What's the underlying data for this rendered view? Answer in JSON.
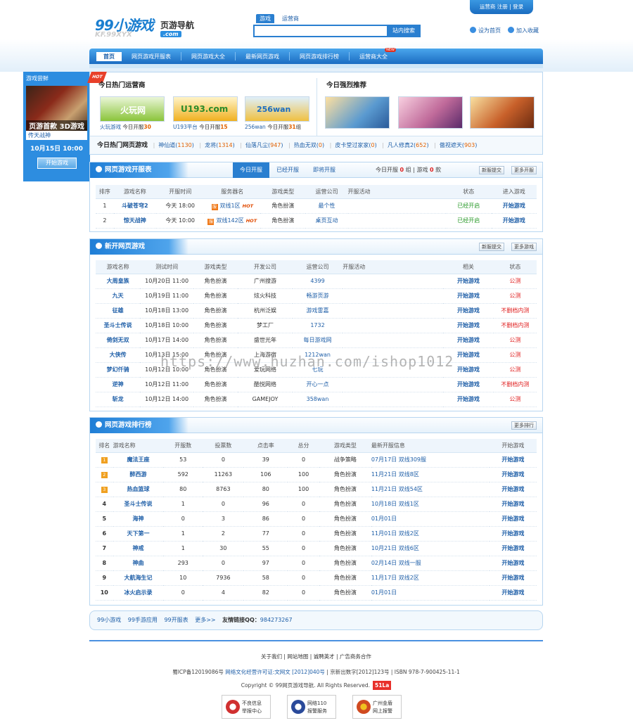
{
  "header": {
    "logo_main": "99小游戏",
    "logo_sub": "页游导航",
    "logo_url": ".com",
    "logo_url_pre": "KF.99XYX",
    "search_tabs": [
      "游戏",
      "运营商"
    ],
    "search_button": "站内搜索",
    "search_placeholder": "",
    "top_links": "运营商 注册 | 登录",
    "set_home": "设为首页",
    "add_fav": "加入收藏"
  },
  "nav": {
    "items": [
      "首页",
      "网页游戏开服表",
      "网页游戏大全",
      "最新网页游戏",
      "网页游戏排行榜",
      "运营商大全"
    ],
    "new_badge": "NEW"
  },
  "left": {
    "title": "游戏尝鲜",
    "img_text": "页游首款 3D游戏",
    "game": "传天战神",
    "date": "10月15日 10:00",
    "button": "开始游戏"
  },
  "hot": {
    "ribbon": "HOT",
    "title_ops": "今日热门运营商",
    "title_rec": "今日强烈推荐",
    "ops": [
      {
        "pic": "火玩网",
        "name": "火玩游戏",
        "label": "今日开服",
        "count": "30",
        "color": "#8ac43a"
      },
      {
        "pic": "U193.com",
        "name": "U193平台",
        "label": "今日开服",
        "count": "15",
        "color": "#f0b020"
      },
      {
        "pic": "256wan",
        "name": "256wan",
        "label": "今日开服",
        "count": "31",
        "color": "#3aa0e0",
        "suffix": "组"
      }
    ],
    "rec_colors": [
      "#5a9ad0",
      "#c06a9a",
      "#c8602a"
    ],
    "hot_label": "今日热门网页游戏",
    "hot_games": [
      {
        "name": "神仙道",
        "count": "1130"
      },
      {
        "name": "龙将",
        "count": "1314"
      },
      {
        "name": "仙落凡尘",
        "count": "947"
      },
      {
        "name": "热血无双",
        "count": "0"
      },
      {
        "name": "皮卡堂过家家",
        "count": "0"
      },
      {
        "name": "凡人修真2",
        "count": "652"
      },
      {
        "name": "傲视遮天",
        "count": "903"
      }
    ]
  },
  "kaifu": {
    "title": "网页游戏开服表",
    "tabs": [
      "今日开服",
      "已经开服",
      "即将开服"
    ],
    "summary_pre": "今日开服",
    "summary_n1": "0",
    "summary_mid": "组 | 游戏",
    "summary_n2": "0",
    "summary_post": "款",
    "btn1": "新服提交",
    "btn2": "更多开服",
    "headers": [
      "排序",
      "游戏名称",
      "开服时间",
      "服务器名",
      "游戏类型",
      "运营公司",
      "开服活动",
      "状态",
      "进入游戏"
    ],
    "rows": [
      {
        "no": "1",
        "name": "斗破苍穹2",
        "time": "今天 18:00",
        "server": "双线1区",
        "type": "角色扮演",
        "company": "最个性",
        "activity": "",
        "status": "已经开启",
        "enter": "开始游戏"
      },
      {
        "no": "2",
        "name": "惊天战神",
        "time": "今天 10:00",
        "server": "双线142区",
        "type": "角色扮演",
        "company": "桌页互动",
        "activity": "",
        "status": "已经开启",
        "enter": "开始游戏"
      }
    ]
  },
  "newgames": {
    "title": "新开网页游戏",
    "btn1": "新服提交",
    "btn2": "更多游戏",
    "headers": [
      "游戏名称",
      "测试时间",
      "游戏类型",
      "开发公司",
      "运营公司",
      "开服活动",
      "相关",
      "状态"
    ],
    "rows": [
      {
        "name": "大周皇族",
        "time": "10月20日 11:00",
        "type": "角色扮演",
        "dev": "广州搜游",
        "op": "4399",
        "act": "",
        "rel": "开始游戏",
        "status": "公测"
      },
      {
        "name": "九天",
        "time": "10月19日 11:00",
        "type": "角色扮演",
        "dev": "炫火科技",
        "op": "畅游页游",
        "act": "",
        "rel": "开始游戏",
        "status": "公测"
      },
      {
        "name": "征雄",
        "time": "10月18日 13:00",
        "type": "角色扮演",
        "dev": "杭州泛娱",
        "op": "游戏雷嘉",
        "act": "",
        "rel": "开始游戏",
        "status": "不删档内测"
      },
      {
        "name": "圣斗士传说",
        "time": "10月18日 10:00",
        "type": "角色扮演",
        "dev": "梦工厂",
        "op": "1732",
        "act": "",
        "rel": "开始游戏",
        "status": "不删档内测"
      },
      {
        "name": "倚剑无双",
        "time": "10月17日 14:00",
        "type": "角色扮演",
        "dev": "盛世光年",
        "op": "每日游戏网",
        "act": "",
        "rel": "开始游戏",
        "status": "公测"
      },
      {
        "name": "大侠传",
        "time": "10月13日 15:00",
        "type": "角色扮演",
        "dev": "上海游宿",
        "op": "1212wan",
        "act": "",
        "rel": "开始游戏",
        "status": "公测"
      },
      {
        "name": "梦幻仟骑",
        "time": "10月12日 10:00",
        "type": "角色扮演",
        "dev": "爱玩网络",
        "op": "七玩",
        "act": "",
        "rel": "开始游戏",
        "status": "公测"
      },
      {
        "name": "逆神",
        "time": "10月12日 11:00",
        "type": "角色扮演",
        "dev": "酷悦网络",
        "op": "开心一点",
        "act": "",
        "rel": "开始游戏",
        "status": "不删档内测"
      },
      {
        "name": "斩龙",
        "time": "10月12日 14:00",
        "type": "角色扮演",
        "dev": "GAMEJOY",
        "op": "358wan",
        "act": "",
        "rel": "开始游戏",
        "status": "公测"
      }
    ]
  },
  "rank": {
    "title": "网页游戏排行榜",
    "btn": "更多排行",
    "headers": [
      "排名",
      "游戏名称",
      "开服数",
      "投票数",
      "点击率",
      "总分",
      "游戏类型",
      "最新开服信息",
      "开始游戏"
    ],
    "rows": [
      {
        "no": "1",
        "name": "魔法王座",
        "kf": "53",
        "vote": "0",
        "click": "39",
        "score": "0",
        "type": "战争策略",
        "info": "07月17日 双线309服",
        "go": "开始游戏"
      },
      {
        "no": "2",
        "name": "醉西游",
        "kf": "592",
        "vote": "11263",
        "click": "106",
        "score": "100",
        "type": "角色扮演",
        "info": "11月21日 双线8区",
        "go": "开始游戏"
      },
      {
        "no": "3",
        "name": "热血篮球",
        "kf": "80",
        "vote": "8763",
        "click": "80",
        "score": "100",
        "type": "角色扮演",
        "info": "11月21日 双线54区",
        "go": "开始游戏"
      },
      {
        "no": "4",
        "name": "圣斗士传说",
        "kf": "1",
        "vote": "0",
        "click": "96",
        "score": "0",
        "type": "角色扮演",
        "info": "10月18日 双线1区",
        "go": "开始游戏"
      },
      {
        "no": "5",
        "name": "海神",
        "kf": "0",
        "vote": "3",
        "click": "86",
        "score": "0",
        "type": "角色扮演",
        "info": "01月01日",
        "go": "开始游戏"
      },
      {
        "no": "6",
        "name": "天下第一",
        "kf": "1",
        "vote": "2",
        "click": "77",
        "score": "0",
        "type": "角色扮演",
        "info": "11月01日 双线2区",
        "go": "开始游戏"
      },
      {
        "no": "7",
        "name": "神戒",
        "kf": "1",
        "vote": "30",
        "click": "55",
        "score": "0",
        "type": "角色扮演",
        "info": "10月21日 双线6区",
        "go": "开始游戏"
      },
      {
        "no": "8",
        "name": "神曲",
        "kf": "293",
        "vote": "0",
        "click": "97",
        "score": "0",
        "type": "角色扮演",
        "info": "02月14日 双线一服",
        "go": "开始游戏"
      },
      {
        "no": "9",
        "name": "大航海生记",
        "kf": "10",
        "vote": "7936",
        "click": "58",
        "score": "0",
        "type": "角色扮演",
        "info": "11月17日 双线2区",
        "go": "开始游戏"
      },
      {
        "no": "10",
        "name": "冰火启示录",
        "kf": "0",
        "vote": "4",
        "click": "82",
        "score": "0",
        "type": "角色扮演",
        "info": "01月01日",
        "go": "开始游戏"
      }
    ]
  },
  "friend_links": {
    "items": [
      "99小游戏",
      "99手游应用",
      "99开服表",
      "更多>>"
    ],
    "qq": "友情链接QQ：",
    "qq_num": "984273267"
  },
  "footer": {
    "links": "关于我们 | 网站地图 | 诚聘英才 | 广告商务合作",
    "icp_a": "蜀ICP备12019086号",
    "icp_b": "网络文化经营许可证:文网文 [2012]040号",
    "icp_c": "| 京新出数字[2012]123号 | ISBN 978-7-900425-11-1",
    "copyright": "Copyright © 99网页游戏导航. All Rights Reserved.",
    "la": "51La",
    "badges": [
      {
        "l1": "不良信息",
        "l2": "举报中心",
        "color": "#d03030"
      },
      {
        "l1": "网络110",
        "l2": "报警服务",
        "color": "#2a4a9a"
      },
      {
        "l1": "广州金盾",
        "l2": "网上报警",
        "color": "#d04a20"
      }
    ]
  },
  "watermark": "https://www.huzhan.com/ishop1012"
}
